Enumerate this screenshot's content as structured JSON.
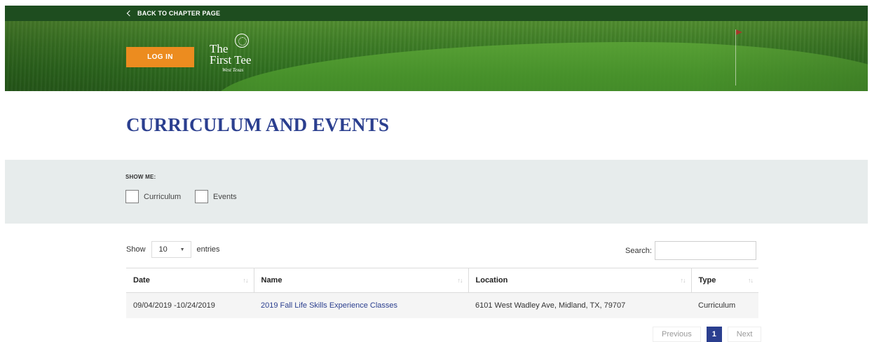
{
  "topbar": {
    "back_label": "BACK TO CHAPTER PAGE"
  },
  "header": {
    "login_label": "LOG IN",
    "logo": {
      "line1": "The",
      "line2": "First Tee",
      "sub": "West Texas"
    }
  },
  "page": {
    "title": "CURRICULUM AND EVENTS"
  },
  "filters": {
    "heading": "SHOW ME:",
    "options": [
      {
        "label": "Curriculum",
        "checked": false
      },
      {
        "label": "Events",
        "checked": false
      }
    ]
  },
  "table_controls": {
    "show_label": "Show",
    "length_value": "10",
    "entries_label": "entries",
    "search_label": "Search:",
    "search_value": ""
  },
  "table": {
    "columns": [
      "Date",
      "Name",
      "Location",
      "Type"
    ],
    "rows": [
      {
        "date": "09/04/2019 -10/24/2019",
        "name": "2019 Fall Life Skills Experience Classes",
        "location": "6101 West Wadley Ave, Midland, TX, 79707",
        "type": "Curriculum"
      }
    ]
  },
  "pagination": {
    "previous": "Previous",
    "current": "1",
    "next": "Next"
  },
  "colors": {
    "accent": "#2b3f8f",
    "login": "#ec8c1f",
    "topbar": "#1e4d1f",
    "panel": "#e7ecec"
  }
}
